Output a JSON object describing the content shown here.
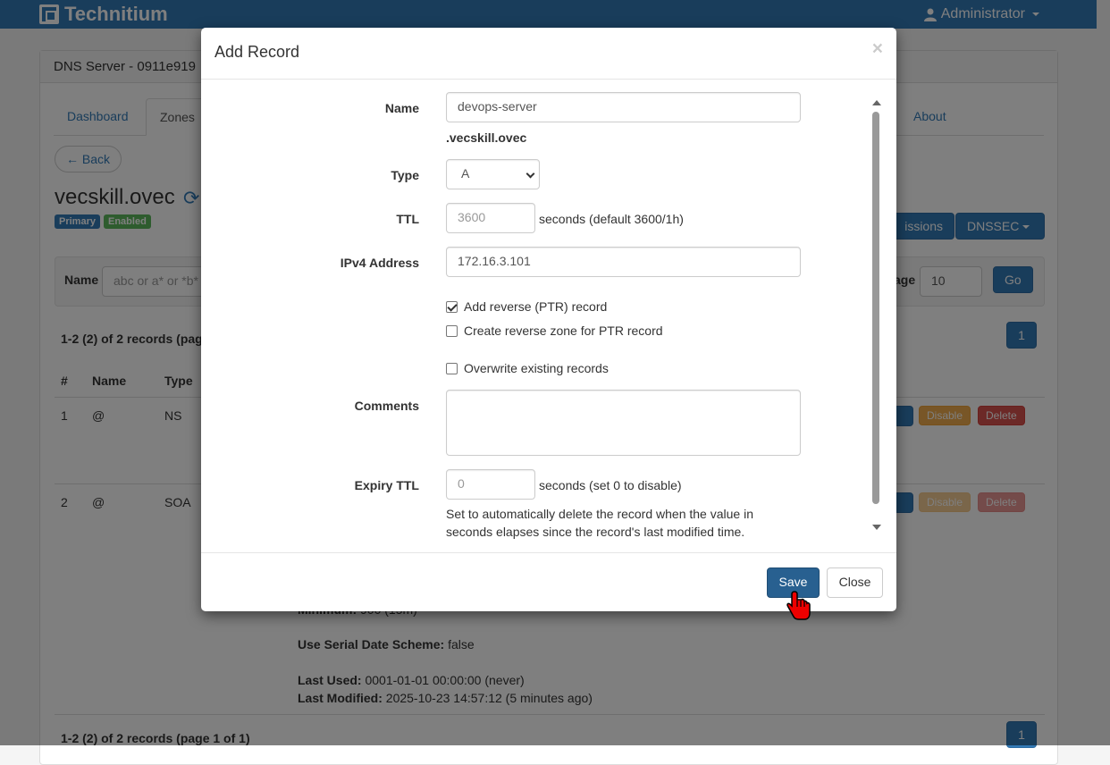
{
  "app": {
    "brand": "Technitium",
    "user": "Administrator"
  },
  "background": {
    "panel_title": "DNS Server - 0911e919",
    "tabs": [
      "Dashboard",
      "Zones",
      "About"
    ],
    "back_label": "← Back",
    "zone_name": "vecskill.ovec",
    "badges": {
      "primary": "Primary",
      "enabled": "Enabled"
    },
    "permissions_label": "issions",
    "dnssec_label": "DNSSEC",
    "filter_name_label": "Name",
    "filter_name_placeholder": "abc or a* or *b*",
    "per_page_label": "age",
    "per_page_value": "10",
    "go_label": "Go",
    "records_summary_top": "1-2 (2) of 2 records (pag",
    "page_number": "1",
    "table_headers": {
      "num": "#",
      "name": "Name",
      "type": "Type"
    },
    "rows": [
      {
        "num": "1",
        "name": "@",
        "type": "NS",
        "disable": "Disable",
        "delete": "Delete"
      },
      {
        "num": "2",
        "name": "@",
        "type": "SOA",
        "disable": "Disable",
        "delete": "Delete"
      }
    ],
    "soa_minimum_label": "Minimum:",
    "soa_minimum_value": "900 (15m)",
    "serial_date_label": "Use Serial Date Scheme:",
    "serial_date_value": "false",
    "last_used_label": "Last Used:",
    "last_used_value": "0001-01-01 00:00:00 (never)",
    "last_modified_label": "Last Modified:",
    "last_modified_value": "2025-10-23 14:57:12 (5 minutes ago)",
    "records_summary_bottom": "1-2 (2) of 2 records (page 1 of 1)"
  },
  "modal": {
    "title": "Add Record",
    "close_glyph": "×",
    "name_label": "Name",
    "name_value": "devops-server",
    "zone_suffix": ".vecskill.ovec",
    "type_label": "Type",
    "type_value": "A",
    "ttl_label": "TTL",
    "ttl_placeholder": "3600",
    "ttl_hint": "seconds (default 3600/1h)",
    "ipv4_label": "IPv4 Address",
    "ipv4_value": "172.16.3.101",
    "add_ptr_label": "Add reverse (PTR) record",
    "add_ptr_checked": true,
    "create_zone_label": "Create reverse zone for PTR record",
    "create_zone_checked": false,
    "overwrite_label": "Overwrite existing records",
    "overwrite_checked": false,
    "comments_label": "Comments",
    "comments_value": "",
    "expiry_label": "Expiry TTL",
    "expiry_placeholder": "0",
    "expiry_hint": "seconds (set 0 to disable)",
    "expiry_help_line1": "Set to automatically delete the record when the value in",
    "expiry_help_line2": "seconds elapses since the record's last modified time.",
    "save_label": "Save",
    "close_label": "Close"
  },
  "colors": {
    "primary": "#337ab7",
    "save": "#286090",
    "success": "#5cb85c",
    "warning": "#f0ad4e",
    "danger": "#d9534f"
  }
}
